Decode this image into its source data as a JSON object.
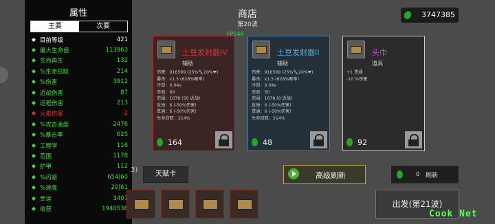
{
  "stats_panel": {
    "title": "属性",
    "tabs": {
      "primary": "主要",
      "secondary": "次要"
    },
    "rows": [
      {
        "label": "目前等级",
        "value": "421",
        "color": "#ffffff",
        "icon": "level-icon"
      },
      {
        "label": "最大生命值",
        "value": "113963",
        "color": "#3fdc3f",
        "icon": "heart-icon"
      },
      {
        "label": "生命再生",
        "value": "132",
        "color": "#3fdc3f",
        "icon": "regen-icon"
      },
      {
        "label": "%生命窃取",
        "value": "214",
        "color": "#3fdc3f",
        "icon": "lifesteal-icon"
      },
      {
        "label": "%伤害",
        "value": "3912",
        "color": "#3fdc3f",
        "icon": "damage-icon"
      },
      {
        "label": "近战伤害",
        "value": "87",
        "color": "#3fdc3f",
        "icon": "melee-icon"
      },
      {
        "label": "远程伤害",
        "value": "213",
        "color": "#3fdc3f",
        "icon": "ranged-icon"
      },
      {
        "label": "元素伤害",
        "value": "-2",
        "color": "#e23434",
        "icon": "element-icon"
      },
      {
        "label": "%攻击速度",
        "value": "2476",
        "color": "#3fdc3f",
        "icon": "attack-speed-icon"
      },
      {
        "label": "%暴击率",
        "value": "625",
        "color": "#3fdc3f",
        "icon": "crit-icon"
      },
      {
        "label": "工程学",
        "value": "116",
        "color": "#3fdc3f",
        "icon": "engineering-icon"
      },
      {
        "label": "范围",
        "value": "1178",
        "color": "#3fdc3f",
        "icon": "range-icon"
      },
      {
        "label": "护甲",
        "value": "112",
        "color": "#3fdc3f",
        "icon": "armor-icon"
      },
      {
        "label": "%闪避",
        "value": "654|60",
        "color": "#3fdc3f",
        "icon": "dodge-icon"
      },
      {
        "label": "%速度",
        "value": "20|61",
        "color": "#3fdc3f",
        "icon": "speed-icon"
      },
      {
        "label": "幸运",
        "value": "3407",
        "color": "#3fdc3f",
        "icon": "luck-icon"
      },
      {
        "label": "收获",
        "value": "1940536",
        "color": "#3fdc3f",
        "icon": "harvest-icon"
      }
    ]
  },
  "header": {
    "title": "商店",
    "wave": "第20波",
    "fps": "FPS46"
  },
  "currency": {
    "amount": "3747385"
  },
  "cards": [
    {
      "name": "土豆发射器IV",
      "type": "辅助",
      "name_color": "#e23434",
      "border": "#b02a2a",
      "bg": "#3a2424",
      "stats": [
        "伤害：916599 (25%🔧20%❤)",
        "暴击：x1.5 (628%概率)",
        "冷却：0.04s",
        "击退：60",
        "范围：1678 (50 近战)",
        "反弹：6 (-50%伤害)",
        "贯通：6 (-50%伤害)",
        "生命窃取：214%"
      ],
      "price": "164",
      "locked": true
    },
    {
      "name": "土豆发射器II",
      "type": "辅助",
      "name_color": "#5aa8e0",
      "border": "#3f7fb0",
      "bg": "#23303a",
      "stats": [
        "伤害：916599 (25%🔧20%❤)",
        "暴击：x1.5 (628%概率)",
        "冷却：0.04s",
        "击退：50",
        "范围：1678 (0 近战)",
        "反弹：6 (-50%伤害)",
        "贯通：6 (-50%伤害)",
        "生命窃取：214%"
      ],
      "price": "48",
      "locked": true
    },
    {
      "name": "头巾",
      "type": "道具",
      "name_color": "#c64bd8",
      "border": "#cfcfcf",
      "bg": "#2b2b2b",
      "stats": [
        "+1 贯通",
        "-10 %伤害"
      ],
      "price": "92",
      "locked": true
    }
  ],
  "bottom": {
    "hidden_btn": "3)",
    "talent": "天赋卡",
    "reroll": "高级刷新",
    "refresh_count": "0",
    "refresh": "刷新",
    "go": "出发(第21波)"
  },
  "watermark": "Cook Net"
}
